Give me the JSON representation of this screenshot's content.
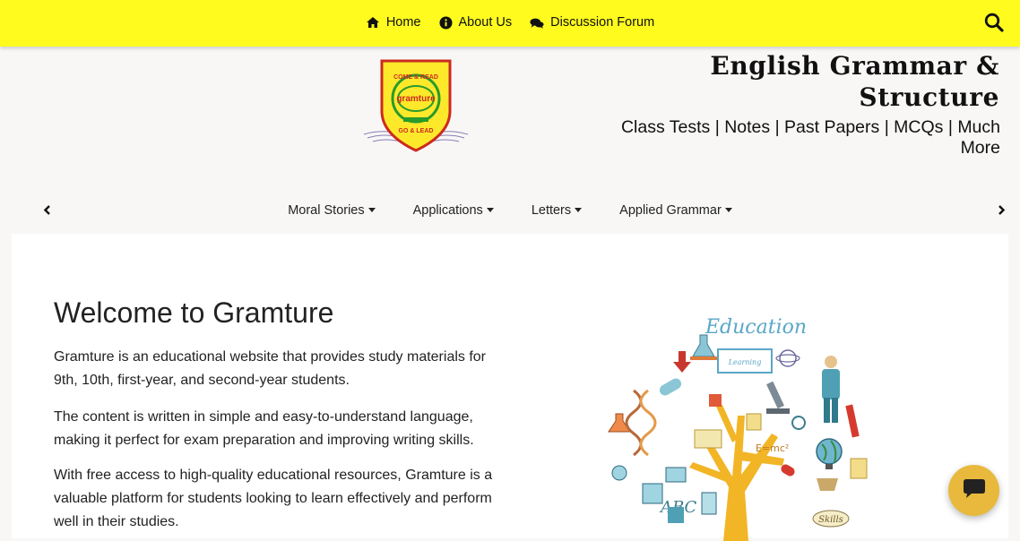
{
  "topnav": {
    "items": [
      {
        "label": "Home",
        "icon": "home-icon"
      },
      {
        "label": "About Us",
        "icon": "info-icon"
      },
      {
        "label": "Discussion Forum",
        "icon": "comments-icon"
      }
    ],
    "search_icon": "search-icon",
    "background": "#fffb1f"
  },
  "logo": {
    "top_text": "COME & READ",
    "center_text": "gramture",
    "bottom_text": "GO & LEAD"
  },
  "brand": {
    "title_line1": "English Grammar &",
    "title_line2": "Structure",
    "subtitle_line1": "Class Tests | Notes | Past Papers | MCQs | Much",
    "subtitle_line2": "More"
  },
  "categories": [
    {
      "label": "Moral Stories"
    },
    {
      "label": "Applications"
    },
    {
      "label": "Letters"
    },
    {
      "label": "Applied Grammar"
    }
  ],
  "main": {
    "heading": "Welcome to Gramture",
    "paragraphs": [
      {
        "line1": "Gramture is an educational website that provides study materials for",
        "line2": "9th, 10th, first-year, and second-year students."
      },
      {
        "line1": "The content is written in simple and easy-to-understand language,",
        "line2": "making it perfect for exam preparation and improving writing skills."
      },
      {
        "line1": "With free access to high-quality educational resources, Gramture is a",
        "line2": "valuable platform for students looking to learn effectively and perform",
        "line3": "well in their studies."
      }
    ],
    "illustration": {
      "title": "Education",
      "e_formula": "E=mc²",
      "abc": "ABC",
      "skills": "Skills",
      "board_text": "Learning"
    }
  },
  "chat": {
    "icon": "chat-icon",
    "color": "#e8b93c"
  }
}
